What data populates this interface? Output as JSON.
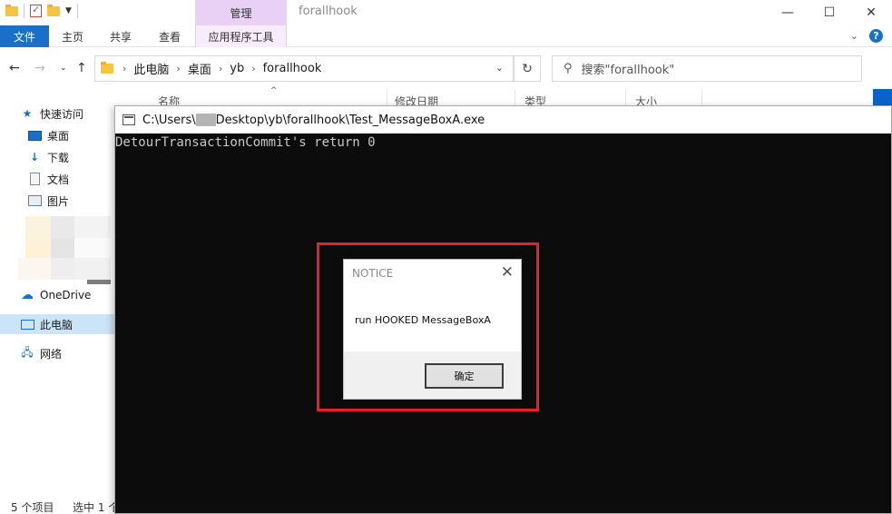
{
  "explorer": {
    "title": "forallhook",
    "context_tab_group": "管理",
    "ribbon_tabs": [
      "文件",
      "主页",
      "共享",
      "查看",
      "应用程序工具"
    ],
    "window_controls": [
      "—",
      "☐",
      "✕"
    ],
    "breadcrumb": [
      "此电脑",
      "桌面",
      "yb",
      "forallhook"
    ],
    "search_placeholder": "搜索\"forallhook\"",
    "columns": [
      "名称",
      "修改日期",
      "类型",
      "大小"
    ],
    "sidebar": {
      "quick_access": "快速访问",
      "desktop": "桌面",
      "downloads": "下载",
      "documents": "文档",
      "pictures": "图片",
      "onedrive": "OneDrive",
      "this_pc": "此电脑",
      "network": "网络"
    },
    "status": {
      "item_count": "5 个项目",
      "selected": "选中 1 个"
    }
  },
  "console": {
    "title_prefix": "C:\\Users\\",
    "title_suffix": "Desktop\\yb\\forallhook\\Test_MessageBoxA.exe",
    "output_line": "DetourTransactionCommit's return 0"
  },
  "message_box": {
    "title": "NOTICE",
    "text": "run HOOKED MessageBoxA",
    "ok_label": "确定"
  },
  "colors": {
    "accent_blue": "#1a6fc6",
    "highlight_red": "#e8202a",
    "console_bg": "#0c0c0c",
    "context_tab": "#e8d1f5"
  }
}
